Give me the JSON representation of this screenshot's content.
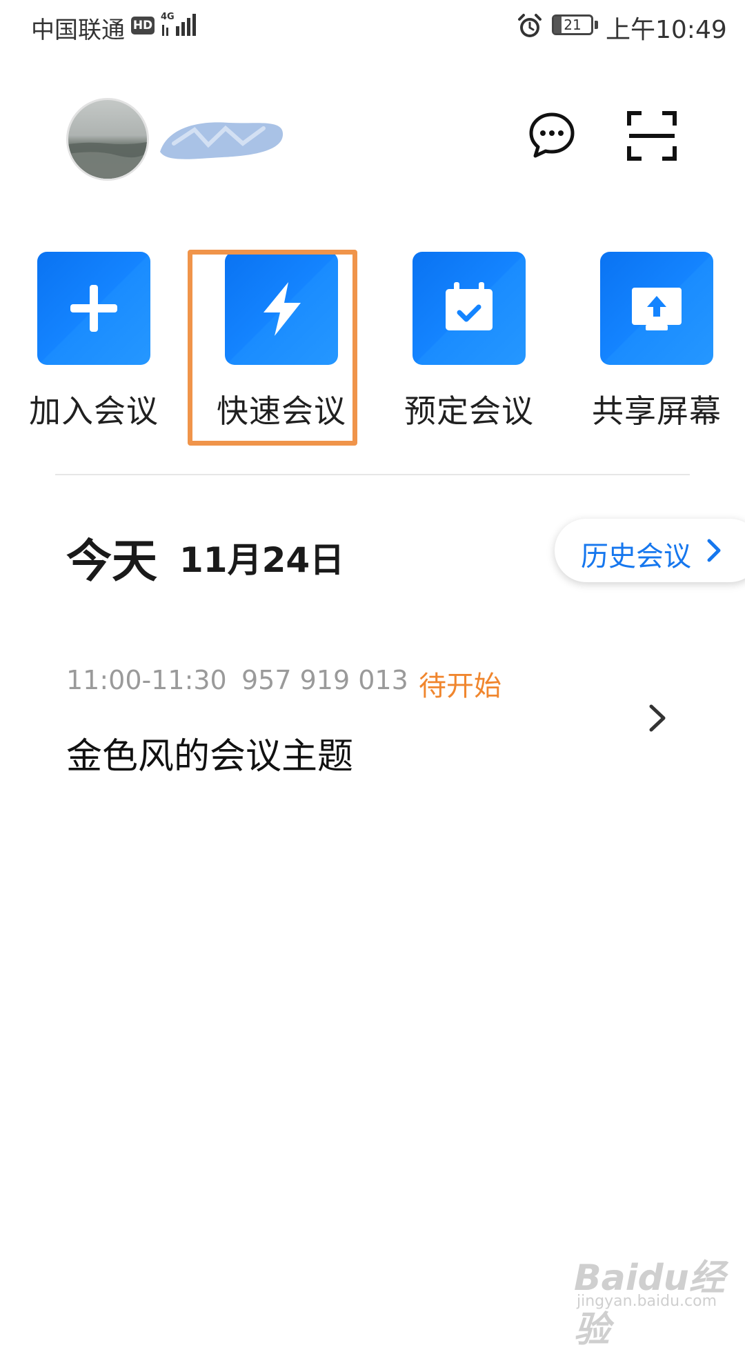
{
  "status_bar": {
    "carrier": "中国联通",
    "hd_badge": "HD",
    "network": "4G",
    "battery_level": "21",
    "time": "上午10:49"
  },
  "header": {
    "avatar_icon": "avatar-photo",
    "chat_icon": "chat-bubble-icon",
    "scan_icon": "scan-icon"
  },
  "quick_actions": [
    {
      "label": "加入会议",
      "icon": "plus-icon"
    },
    {
      "label": "快速会议",
      "icon": "lightning-icon"
    },
    {
      "label": "预定会议",
      "icon": "calendar-check-icon"
    },
    {
      "label": "共享屏幕",
      "icon": "share-screen-icon"
    }
  ],
  "today": {
    "label": "今天",
    "date": "11月24日",
    "history_button": "历史会议"
  },
  "meetings": [
    {
      "time": "11:00-11:30",
      "meeting_id": "957 919 013",
      "status": "待开始",
      "title": "金色风的会议主题"
    }
  ],
  "watermark": {
    "brand": "Baidu经验",
    "url": "jingyan.baidu.com"
  },
  "colors": {
    "accent_blue": "#1484ff",
    "status_orange": "#f0862e",
    "highlight_orange": "#f0944a"
  }
}
